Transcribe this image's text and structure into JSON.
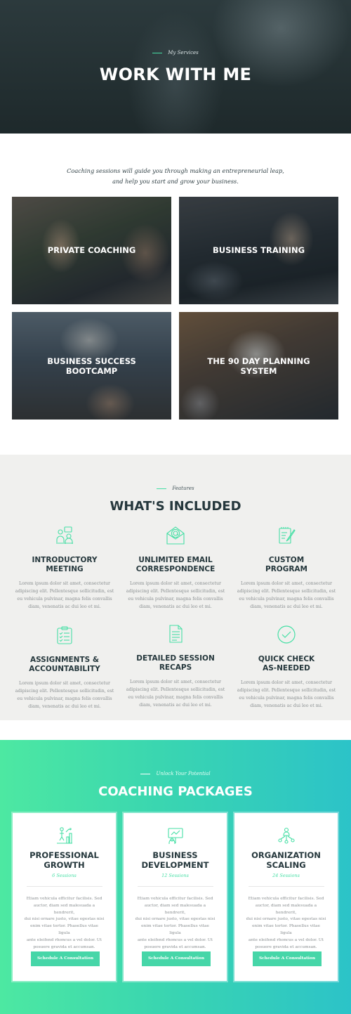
{
  "hero": {
    "eyebrow": "My Services",
    "title": "WORK WITH ME"
  },
  "intro": {
    "line1": "Coaching sessions will guide you through making an entrepreneurial leap,",
    "line2": "and help you start and grow your business."
  },
  "services": [
    {
      "line1": "PRIVATE COACHING",
      "line2": ""
    },
    {
      "line1": "BUSINESS TRAINING",
      "line2": ""
    },
    {
      "line1": "BUSINESS SUCCESS",
      "line2": "BOOTCAMP"
    },
    {
      "line1": "THE 90 DAY PLANNING",
      "line2": "SYSTEM"
    }
  ],
  "features": {
    "eyebrow": "Features",
    "title": "WHAT'S INCLUDED",
    "items": [
      {
        "icon": "team-meeting-icon",
        "line1": "INTRODUCTORY",
        "line2": "MEETING",
        "body1": "Lorem ipsum dolor sit amet, consectetur",
        "body2": "adipiscing elit. Pellentesque sollicitudin, est",
        "body3": "eu vehicula pulvinar, magna felis convallis",
        "body4": "diam, venenatis ac dui leo et mi."
      },
      {
        "icon": "email-envelope-icon",
        "line1": "UNLIMITED EMAIL",
        "line2": "CORRESPONDENCE",
        "body1": "Lorem ipsum dolor sit amet, consectetur",
        "body2": "adipiscing elit. Pellentesque sollicitudin, est",
        "body3": "eu vehicula pulvinar, magna felis convallis",
        "body4": "diam, venenatis ac dui leo et mi."
      },
      {
        "icon": "custom-program-icon",
        "line1": "CUSTOM",
        "line2": "PROGRAM",
        "body1": "Lorem ipsum dolor sit amet, consectetur",
        "body2": "adipiscing elit. Pellentesque sollicitudin, est",
        "body3": "eu vehicula pulvinar, magna felis convallis",
        "body4": "diam, venenatis ac dui leo et mi."
      },
      {
        "icon": "clipboard-checklist-icon",
        "line1": "ASSIGNMENTS &",
        "line2": "ACCOUNTABILITY",
        "body1": "Lorem ipsum dolor sit amet, consectetur",
        "body2": "adipiscing elit. Pellentesque sollicitudin, est",
        "body3": "eu vehicula pulvinar, magna felis convallis",
        "body4": "diam, venenatis ac dui leo et mi."
      },
      {
        "icon": "document-icon",
        "line1": "DETAILED SESSION",
        "line2": "RECAPS",
        "body1": "Lorem ipsum dolor sit amet, consectetur",
        "body2": "adipiscing elit. Pellentesque sollicitudin, est",
        "body3": "eu vehicula pulvinar, magna felis convallis",
        "body4": "diam, venenatis ac dui leo et mi."
      },
      {
        "icon": "check-circle-icon",
        "line1": "QUICK CHECK",
        "line2": "AS-NEEDED",
        "body1": "Lorem ipsum dolor sit amet, consectetur",
        "body2": "adipiscing elit. Pellentesque sollicitudin, est",
        "body3": "eu vehicula pulvinar, magna felis convallis",
        "body4": "diam, venenatis ac dui leo et mi."
      }
    ]
  },
  "packages": {
    "eyebrow": "Unlock Your Potential",
    "title": "COACHING PACKAGES",
    "items": [
      {
        "icon": "growth-person-icon",
        "line1": "PROFESSIONAL",
        "line2": "GROWTH",
        "sessions": "6 Sessions",
        "body1": "Etiam vehicula efficitur facilisis. Sed",
        "body2": "auctor, diam sed malesuada a hendrerit,",
        "body3": "dui nisi ornare justo, vitae egestas nisi",
        "body4": "enim vitae tortor. Phasellus vitae ligula",
        "body5": "ante eleifend rhoncus a vel dolor. Ut",
        "body6": "posuere gravida et accumsan.",
        "button": "Schedule A Consultation"
      },
      {
        "icon": "presentation-icon",
        "line1": "BUSINESS",
        "line2": "DEVELOPMENT",
        "sessions": "12 Sessions",
        "body1": "Etiam vehicula efficitur facilisis. Sed",
        "body2": "auctor, diam sed malesuada a hendrerit,",
        "body3": "dui nisi ornare justo, vitae egestas nisi",
        "body4": "enim vitae tortor. Phasellus vitae ligula",
        "body5": "ante eleifend rhoncus a vel dolor. Ut",
        "body6": "posuere gravida et accumsan.",
        "button": "Schedule A Consultation"
      },
      {
        "icon": "organization-network-icon",
        "line1": "ORGANIZATION",
        "line2": "SCALING",
        "sessions": "24 Sessions",
        "body1": "Etiam vehicula efficitur facilisis. Sed",
        "body2": "auctor, diam sed malesuada a hendrerit,",
        "body3": "dui nisi ornare justo, vitae egestas nisi",
        "body4": "enim vitae tortor. Phasellus vitae ligula",
        "body5": "ante eleifend rhoncus a vel dolor. Ut",
        "body6": "posuere gravida et accumsan.",
        "button": "Schedule A Consultation"
      }
    ]
  },
  "colors": {
    "accent": "#46dfa5",
    "dark": "#25373c",
    "gradient_start": "#4de8a2",
    "gradient_end": "#2cc3c8",
    "button": "#46d6a8"
  }
}
